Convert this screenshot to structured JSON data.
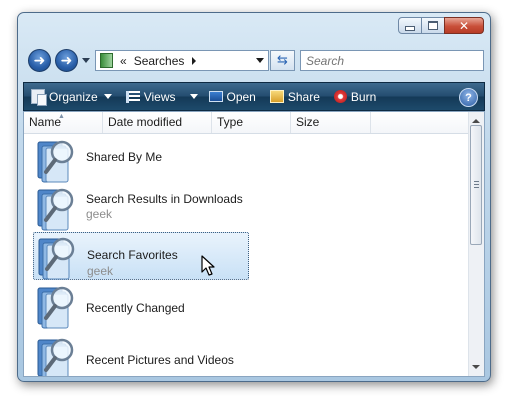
{
  "window": {
    "caption_buttons": {
      "minimize_icon": "minimize-icon",
      "maximize_icon": "maximize-icon",
      "close_icon": "close-icon",
      "close_glyph": "✕"
    }
  },
  "navigation": {
    "back_icon": "back-arrow-icon",
    "forward_icon": "forward-arrow-icon",
    "address": {
      "prefix": "«",
      "location": "Searches"
    },
    "refresh_icon": "refresh-icon",
    "search_placeholder": "Search"
  },
  "toolbar": {
    "organize": "Organize",
    "views": "Views",
    "open": "Open",
    "share": "Share",
    "burn": "Burn",
    "help": "?"
  },
  "columns": [
    "Name",
    "Date modified",
    "Type",
    "Size"
  ],
  "items": [
    {
      "title": "Shared By Me",
      "subtitle": "",
      "selected": false
    },
    {
      "title": "Search Results in Downloads",
      "subtitle": "geek",
      "selected": false
    },
    {
      "title": "Search Favorites",
      "subtitle": "geek",
      "selected": true
    },
    {
      "title": "Recently Changed",
      "subtitle": "",
      "selected": false
    },
    {
      "title": "Recent Pictures and Videos",
      "subtitle": "",
      "selected": false
    }
  ],
  "colors": {
    "toolbar_bg": "#1d4a6b",
    "selection_bg": "#c9e1f6",
    "subtitle_text": "#8d8d8d"
  }
}
